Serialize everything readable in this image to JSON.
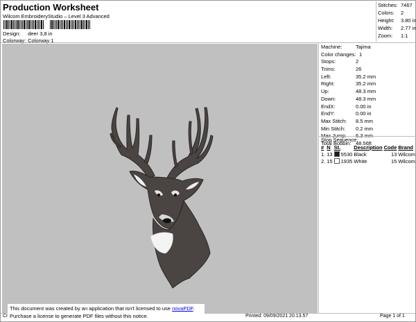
{
  "header": {
    "title": "Production Worksheet",
    "subtitle": "Wilcom EmbroideryStudio – Level 3 Advanced",
    "barcode_mark": "·"
  },
  "meta": {
    "design_label": "Design:",
    "design_value": "deer 3,8 in",
    "colorway_label": "Colorway:",
    "colorway_value": "Colorway 1"
  },
  "summary": [
    {
      "label": "Stitches:",
      "value": "7467"
    },
    {
      "label": "Colors:",
      "value": "2"
    },
    {
      "label": "Height:",
      "value": "3.80 in"
    },
    {
      "label": "Width:",
      "value": "2.77 in"
    },
    {
      "label": "Zoom:",
      "value": "1:1"
    }
  ],
  "properties": [
    {
      "label": "Machine:",
      "value": "Tajima"
    },
    {
      "label": "Color changes:",
      "value": "1"
    },
    {
      "label": "Stops:",
      "value": "2"
    },
    {
      "label": "Trims:",
      "value": "26"
    },
    {
      "label": "Left:",
      "value": "35.2 mm"
    },
    {
      "label": "Right:",
      "value": "35.2 mm"
    },
    {
      "label": "Up:",
      "value": "48.3 mm"
    },
    {
      "label": "Down:",
      "value": "48.3 mm"
    },
    {
      "label": "EndX:",
      "value": "0.00 in"
    },
    {
      "label": "EndY:",
      "value": "0.00 in"
    },
    {
      "label": "Max Stitch:",
      "value": "8.5 mm"
    },
    {
      "label": "Min Stitch:",
      "value": "0.2 mm"
    },
    {
      "label": "Max Jump:",
      "value": "6.3 mm"
    },
    {
      "label": "Total Bobbin:",
      "value": "48.56ft"
    }
  ],
  "stop_sequence": {
    "heading": "Stop Sequence:",
    "columns": [
      "#",
      "N",
      "St.",
      "Description",
      "Code",
      "Brand"
    ],
    "rows": [
      {
        "index": "1.",
        "n": "13",
        "swatch": "#1a1a1a",
        "st": "5530",
        "description": "Black",
        "code": "13",
        "brand": "Wilcom"
      },
      {
        "index": "2.",
        "n": "15",
        "swatch": "#ffffff",
        "st": "1935",
        "description": "White",
        "code": "15",
        "brand": "Wilcom"
      }
    ]
  },
  "design_area": {
    "background": "#c0c0c0"
  },
  "notice": {
    "line1_prefix": "This document was created by an application that isn't licensed to use ",
    "link": "novaPDF",
    "line1_suffix": ".",
    "line2": "Purchase a license to generate PDF files without this notice."
  },
  "footer": {
    "left": "Cr",
    "printed": "Printed: 09/09/2021 20.13.57",
    "page": "Page 1 of 1"
  }
}
